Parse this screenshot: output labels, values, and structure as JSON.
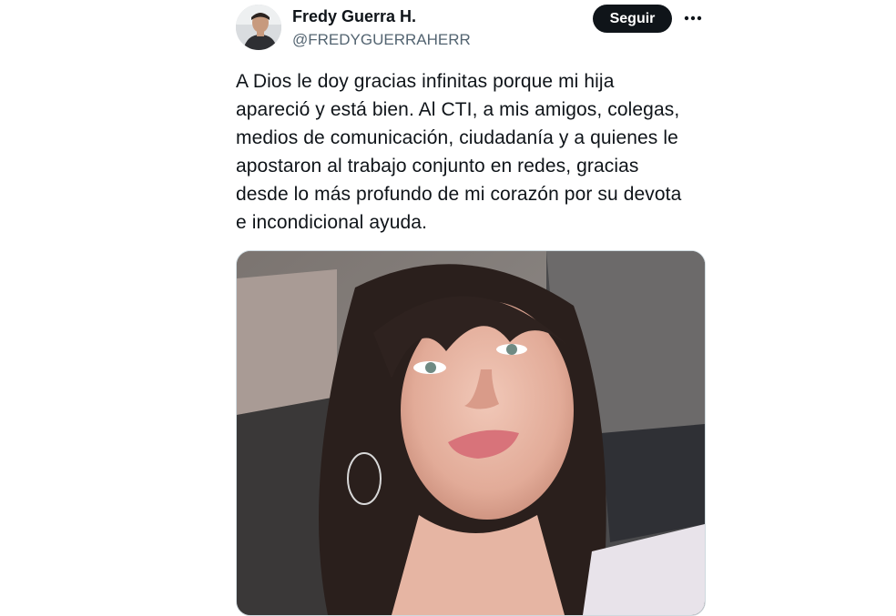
{
  "author": {
    "name": "Fredy Guerra H.",
    "handle": "@FREDYGUERRAHERR"
  },
  "actions": {
    "follow_label": "Seguir",
    "more_icon": "more-horizontal-icon"
  },
  "tweet": {
    "text": "A Dios le doy gracias infinitas porque mi hija\napareció y está bien. Al CTI, a mis amigos, colegas,\nmedios de comunicación, ciudadanía y a quienes le\napostaron al trabajo conjunto en redes, gracias\ndesde lo más profundo de mi corazón por su devota\ne incondicional ayuda."
  },
  "colors": {
    "text_primary": "#0f1419",
    "text_secondary": "#536471",
    "button_bg": "#0f1419",
    "button_text": "#ffffff"
  }
}
